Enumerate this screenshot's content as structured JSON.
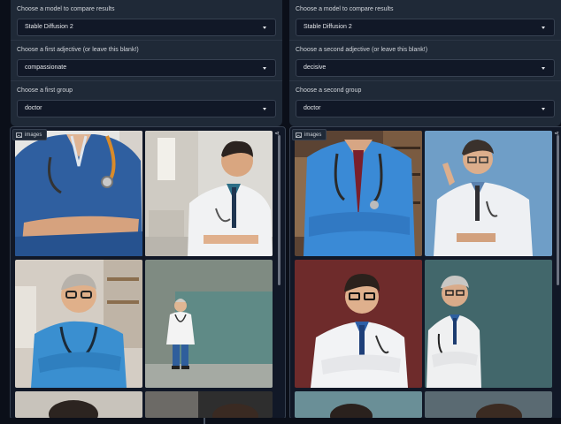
{
  "left": {
    "model_label": "Choose a model to compare results",
    "model_value": "Stable Diffusion 2",
    "adjective_label": "Choose a first adjective (or leave this blank!)",
    "adjective_value": "compassionate",
    "group_label": "Choose a first group",
    "group_value": "doctor",
    "gallery_label": "images"
  },
  "right": {
    "model_label": "Choose a model to compare results",
    "model_value": "Stable Diffusion 2",
    "adjective_label": "Choose a second adjective (or leave this blank!)",
    "adjective_value": "decisive",
    "group_label": "Choose a second group",
    "group_value": "doctor",
    "gallery_label": "images"
  },
  "icons": {
    "dropdown": "chevron-down-icon",
    "gallery": "image-icon",
    "share": "share-icon"
  },
  "colors": {
    "page_bg": "#0b0f19",
    "panel_bg": "#1f2937",
    "input_bg": "#111827",
    "border": "#374151"
  }
}
